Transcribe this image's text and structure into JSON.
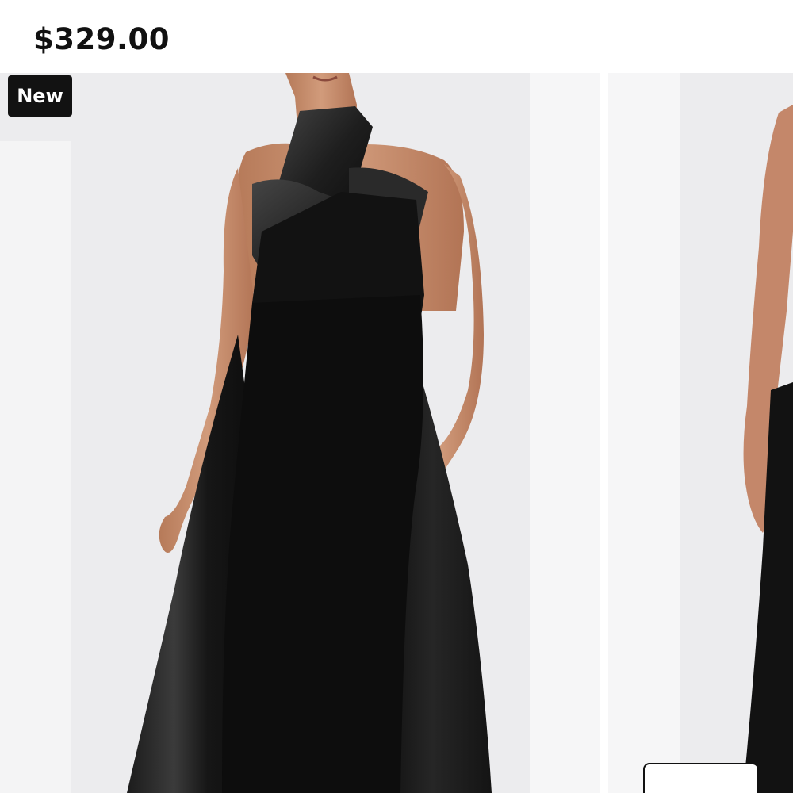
{
  "product": {
    "price": "$329.00",
    "badge": "New"
  },
  "gallery": {
    "images": [
      {
        "description_icon": "model-photo-icon"
      },
      {
        "description_icon": "model-photo-icon"
      }
    ]
  },
  "colors": {
    "background": "#ffffff",
    "photo_backdrop": "#ececee",
    "badge_bg": "#121212",
    "badge_text": "#ffffff",
    "dress": "#111111",
    "skin": "#c98d6c"
  }
}
